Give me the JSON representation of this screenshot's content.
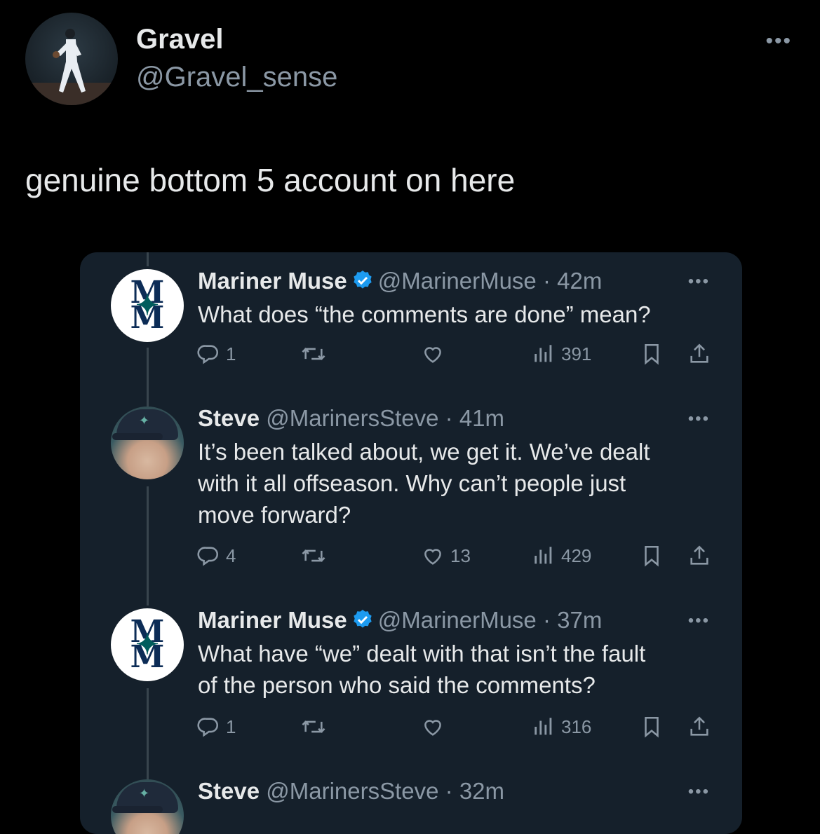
{
  "post": {
    "author_name": "Gravel",
    "author_handle": "@Gravel_sense",
    "more_label": "•••",
    "text": "genuine bottom 5 account on here"
  },
  "embedded_thread": {
    "tweets": [
      {
        "name": "Mariner Muse",
        "verified": true,
        "handle": "@MarinerMuse",
        "time": "· 42m",
        "text": "What does “the comments are done” mean?",
        "replies": "1",
        "retweets": "",
        "likes": "",
        "views": "391",
        "avatar": "mariners-m-logo"
      },
      {
        "name": "Steve",
        "verified": false,
        "handle": "@MarinersSteve",
        "time": "· 41m",
        "text_lines": [
          "It’s been talked about, we get it. We’ve dealt",
          "with it all offseason. Why can’t people just",
          "move forward?"
        ],
        "replies": "4",
        "retweets": "",
        "likes": "13",
        "views": "429",
        "avatar": "steve-photo"
      },
      {
        "name": "Mariner Muse",
        "verified": true,
        "handle": "@MarinerMuse",
        "time": "· 37m",
        "text_lines": [
          "What have “we” dealt with that isn’t the fault",
          "of the person who said the comments?"
        ],
        "replies": "1",
        "retweets": "",
        "likes": "",
        "views": "316",
        "avatar": "mariners-m-logo"
      },
      {
        "name": "Steve",
        "verified": false,
        "handle": "@MarinersSteve",
        "time": "· 32m",
        "avatar": "steve-photo"
      }
    ],
    "more_label": "•••",
    "logo_letters": "M",
    "accent_color": "#1d9bf0"
  }
}
